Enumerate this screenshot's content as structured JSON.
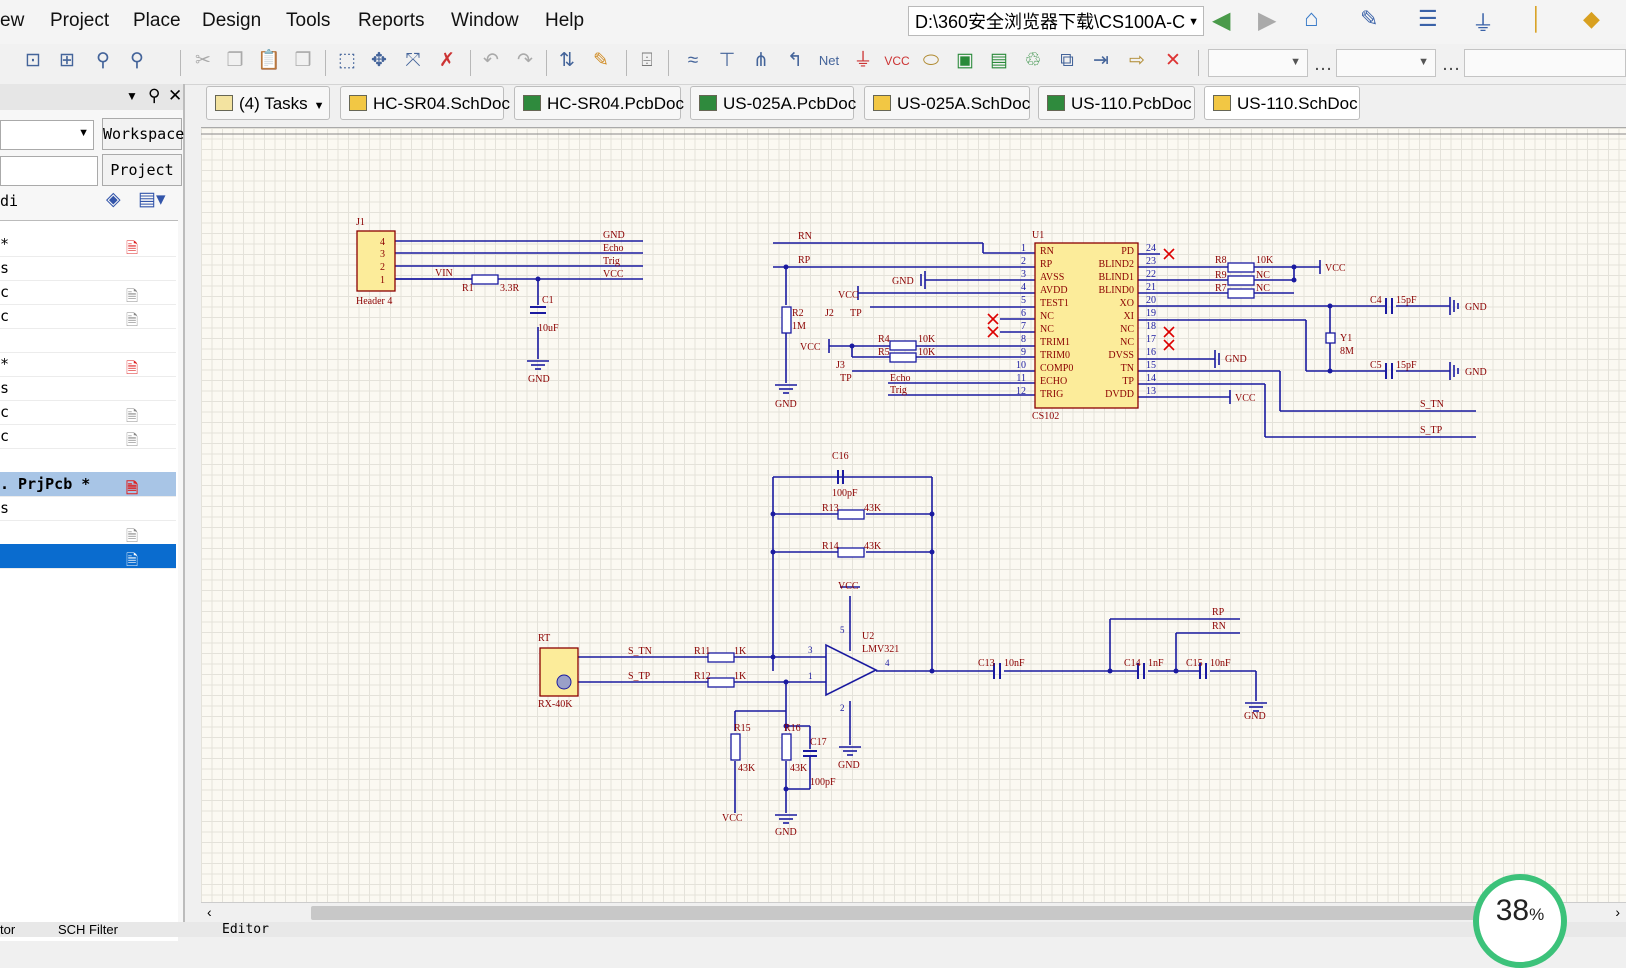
{
  "menu": [
    "ew",
    "Project",
    "Place",
    "Design",
    "Tools",
    "Reports",
    "Window",
    "Help"
  ],
  "path": "D:\\360安全浏览器下载\\CS100A-C",
  "left_panel": {
    "workspace_btn": "Workspace",
    "project_btn": "Project",
    "filter_text": "di",
    "rows": [
      "*",
      "s",
      "c",
      "c",
      "",
      "*",
      "s",
      "c",
      "c",
      "",
      ". PrjPcb *",
      "s",
      "",
      ""
    ]
  },
  "tabs": [
    "(4) Tasks",
    "HC-SR04.SchDoc",
    "HC-SR04.PcbDoc",
    "US-025A.PcbDoc",
    "US-025A.SchDoc",
    "US-110.PcbDoc",
    "US-110.SchDoc"
  ],
  "bottom_tabs": [
    "tor",
    "SCH Filter",
    "Editor"
  ],
  "zoom_value": "38",
  "zoom_unit": "%",
  "colors": {
    "wire": "#1a1aa0",
    "label": "#8b0000",
    "component": "#fcec9a",
    "compborder": "#8b0000",
    "canvas": "#fbf9f2"
  },
  "schematic": {
    "j1": {
      "ref": "J1",
      "name": "Header 4",
      "pins": [
        "4",
        "3",
        "2",
        "1"
      ],
      "nets": [
        "GND",
        "Echo",
        "Trig",
        "VCC"
      ],
      "vin": "VIN"
    },
    "r1": {
      "ref": "R1",
      "value": "3.3R"
    },
    "c1": {
      "ref": "C1",
      "value": "10uF"
    },
    "gnd": "GND",
    "vcc": "VCC",
    "u1": {
      "ref": "U1",
      "name": "CS102",
      "left_pins": [
        [
          "1",
          "RN"
        ],
        [
          "2",
          "RP"
        ],
        [
          "3",
          "AVSS"
        ],
        [
          "4",
          "AVDD"
        ],
        [
          "5",
          "TEST1"
        ],
        [
          "6",
          "NC"
        ],
        [
          "7",
          "NC"
        ],
        [
          "8",
          "TRIM1"
        ],
        [
          "9",
          "TRIM0"
        ],
        [
          "10",
          "COMP0"
        ],
        [
          "11",
          "ECHO"
        ],
        [
          "12",
          "TRIG"
        ]
      ],
      "right_pins": [
        [
          "24",
          "PD"
        ],
        [
          "23",
          "BLIND2"
        ],
        [
          "22",
          "BLIND1"
        ],
        [
          "21",
          "BLIND0"
        ],
        [
          "20",
          "XO"
        ],
        [
          "19",
          "XI"
        ],
        [
          "18",
          "NC"
        ],
        [
          "17",
          "NC"
        ],
        [
          "16",
          "DVSS"
        ],
        [
          "15",
          "TN"
        ],
        [
          "14",
          "TP"
        ],
        [
          "13",
          "DVDD"
        ]
      ]
    },
    "rn": "RN",
    "rp": "RP",
    "r2": {
      "ref": "R2",
      "value": "1M"
    },
    "j2": {
      "ref": "J2",
      "pin": "TP"
    },
    "j3": {
      "ref": "J3",
      "pin": "TP"
    },
    "r4": {
      "ref": "R4",
      "value": "10K"
    },
    "r5": {
      "ref": "R5",
      "value": "10K"
    },
    "echo": "Echo",
    "trig": "Trig",
    "r8": {
      "ref": "R8",
      "value": "10K"
    },
    "r9": {
      "ref": "R9",
      "value": "NC"
    },
    "r7": {
      "ref": "R7",
      "value": "NC"
    },
    "c4": {
      "ref": "C4",
      "value": "15pF"
    },
    "c5": {
      "ref": "C5",
      "value": "15pF"
    },
    "y1": {
      "ref": "Y1",
      "value": "8M"
    },
    "s_tn": "S_TN",
    "s_tp": "S_TP",
    "c16": {
      "ref": "C16",
      "value": "100pF"
    },
    "r13": {
      "ref": "R13",
      "value": "43K"
    },
    "r14": {
      "ref": "R14",
      "value": "43K"
    },
    "rt": {
      "ref": "RT",
      "name": "RX-40K"
    },
    "r11": {
      "ref": "R11",
      "value": "1K"
    },
    "r12": {
      "ref": "R12",
      "value": "1K"
    },
    "u2": {
      "ref": "U2",
      "name": "LMV321"
    },
    "r15": {
      "ref": "R15",
      "value": "43K"
    },
    "r16": {
      "ref": "R16",
      "value": "43K"
    },
    "c17": {
      "ref": "C17",
      "value": "100pF"
    },
    "c13": {
      "ref": "C13",
      "value": "10nF"
    },
    "c14": {
      "ref": "C14",
      "value": "1nF"
    },
    "c15": {
      "ref": "C15",
      "value": "10nF"
    },
    "pins_u2": [
      "3",
      "1",
      "4",
      "5",
      "2"
    ]
  }
}
